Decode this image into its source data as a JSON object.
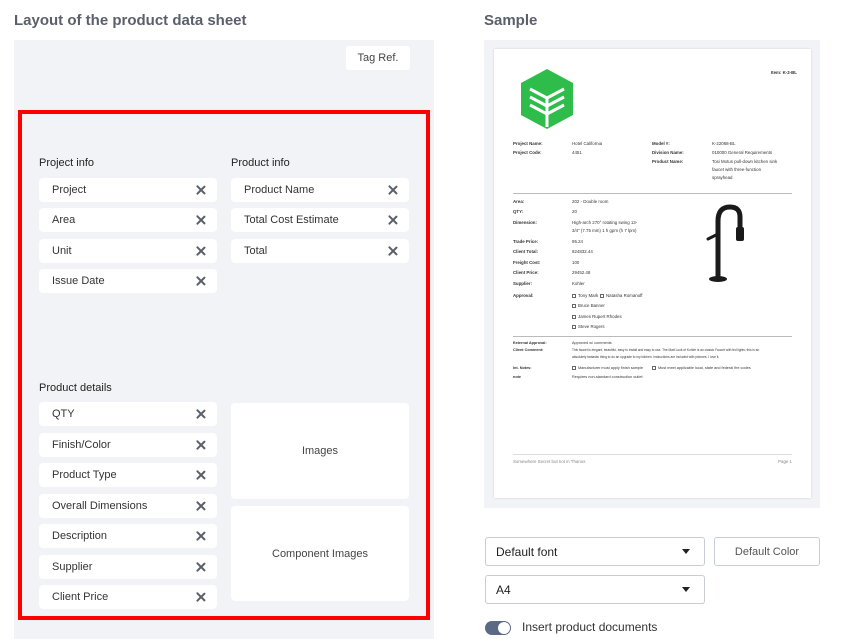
{
  "layout": {
    "title": "Layout of the product data sheet",
    "tag_ref": "Tag Ref.",
    "project_info": {
      "label": "Project info",
      "items": [
        "Project",
        "Area",
        "Unit",
        "Issue Date"
      ]
    },
    "product_info": {
      "label": "Product info",
      "items": [
        "Product Name",
        "Total Cost Estimate",
        "Total"
      ]
    },
    "product_details": {
      "label": "Product details",
      "items": [
        "QTY",
        "Finish/Color",
        "Product Type",
        "Overall Dimensions",
        "Description",
        "Supplier",
        "Client Price"
      ]
    },
    "images_label": "Images",
    "component_images_label": "Component Images"
  },
  "sample": {
    "title": "Sample",
    "item": "Item: K-2-BL",
    "project_name_label": "Project Name:",
    "project_name": "Hotel California",
    "project_code_label": "Project Code:",
    "project_code": "4451",
    "model_label": "Model #:",
    "model": "K-22068-BL",
    "division_label": "Division Name:",
    "division": "010000 General Requirements",
    "product_name_label": "Product Name:",
    "product_name_1": "Tosi Motus pull-down kitchen sink",
    "product_name_2": "faucet with three-function",
    "product_name_3": "sprayhead",
    "rows": [
      {
        "label": "Area:",
        "value": "202 - Double room"
      },
      {
        "label": "QTY:",
        "value": "20"
      },
      {
        "label": "Dimension:",
        "value": "High-arch 270° rotating swing 13-"
      },
      {
        "label": "",
        "value": "3/4\" (7.75 mm) 1 h gpm (h 7 lpm)"
      },
      {
        "label": "Trade Price:",
        "value": "95.24"
      },
      {
        "label": "Client Total:",
        "value": "824832.44"
      },
      {
        "label": "Freight Cost:",
        "value": "100"
      },
      {
        "label": "Client Price:",
        "value": "29452.48"
      },
      {
        "label": "Supplier:",
        "value": "Kohler"
      }
    ],
    "approval_label": "Approval:",
    "approvals": [
      "Tony Mark",
      "Natasha Romanoff",
      "Bruce Banner",
      "James Rupert Rhodes",
      "Steve Rogers"
    ],
    "external_label": "External Approval:",
    "external_value": "Approved w/ comments",
    "client_comment_label": "Client Comment:",
    "client_comment_1": "This faucet is elegant, beautiful, easy to install and easy to use. The Matt Look of Kohler is an classic Faucet with led lights; this is an",
    "client_comment_2": "absolutely fantastic thing to do an upgrade to my kitchen. Instructions are included with pictures. I love it.",
    "int_notes_label": "Int. Notes:",
    "int_note_1": "Manufacturer must apply finish sample",
    "int_note_2": "Must meet applicable local, state and federal fire codes",
    "note_label": "note",
    "note_value": "Requires non-standard construction outlet",
    "footer_left": "Somewhere Secret but not in Thanos",
    "footer_right": "Page 1"
  },
  "controls": {
    "font_select": "Default font",
    "default_color": "Default Color",
    "size_select": "A4",
    "insert_docs": "Insert product documents"
  },
  "colors": {
    "highlight_border": "#ff0000",
    "panel_bg": "#f2f3f7",
    "logo_green": "#2ebd4a",
    "toggle_on": "#5a6a85"
  }
}
